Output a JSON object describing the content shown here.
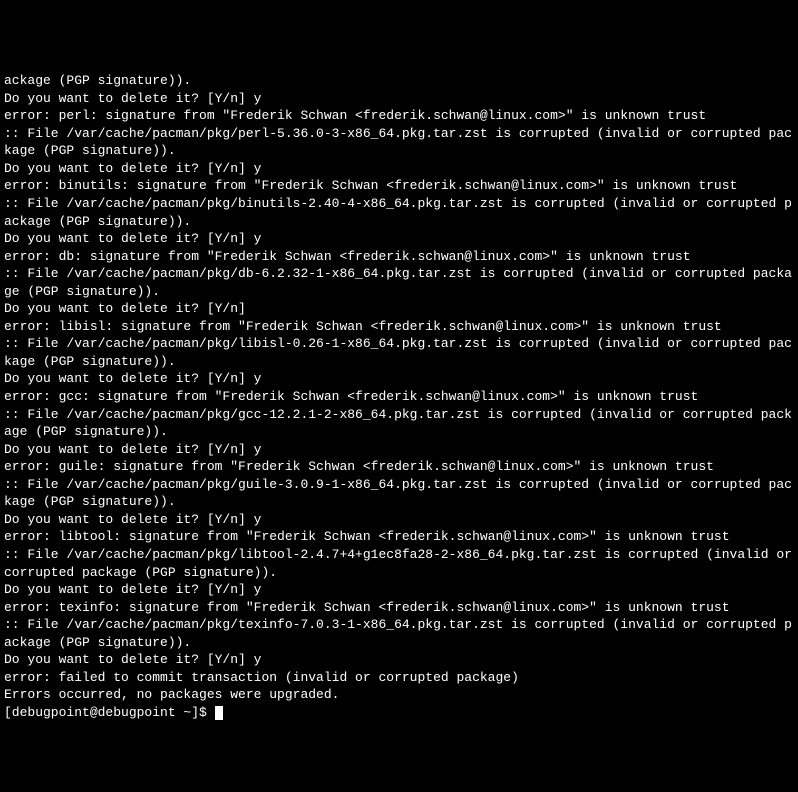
{
  "lines": [
    "ackage (PGP signature)).",
    "Do you want to delete it? [Y/n] y",
    "error: perl: signature from \"Frederik Schwan <frederik.schwan@linux.com>\" is unknown trust",
    ":: File /var/cache/pacman/pkg/perl-5.36.0-3-x86_64.pkg.tar.zst is corrupted (invalid or corrupted package (PGP signature)).",
    "Do you want to delete it? [Y/n] y",
    "error: binutils: signature from \"Frederik Schwan <frederik.schwan@linux.com>\" is unknown trust",
    ":: File /var/cache/pacman/pkg/binutils-2.40-4-x86_64.pkg.tar.zst is corrupted (invalid or corrupted package (PGP signature)).",
    "Do you want to delete it? [Y/n] y",
    "error: db: signature from \"Frederik Schwan <frederik.schwan@linux.com>\" is unknown trust",
    ":: File /var/cache/pacman/pkg/db-6.2.32-1-x86_64.pkg.tar.zst is corrupted (invalid or corrupted package (PGP signature)).",
    "Do you want to delete it? [Y/n]",
    "error: libisl: signature from \"Frederik Schwan <frederik.schwan@linux.com>\" is unknown trust",
    ":: File /var/cache/pacman/pkg/libisl-0.26-1-x86_64.pkg.tar.zst is corrupted (invalid or corrupted package (PGP signature)).",
    "Do you want to delete it? [Y/n] y",
    "error: gcc: signature from \"Frederik Schwan <frederik.schwan@linux.com>\" is unknown trust",
    ":: File /var/cache/pacman/pkg/gcc-12.2.1-2-x86_64.pkg.tar.zst is corrupted (invalid or corrupted package (PGP signature)).",
    "Do you want to delete it? [Y/n] y",
    "error: guile: signature from \"Frederik Schwan <frederik.schwan@linux.com>\" is unknown trust",
    ":: File /var/cache/pacman/pkg/guile-3.0.9-1-x86_64.pkg.tar.zst is corrupted (invalid or corrupted package (PGP signature)).",
    "Do you want to delete it? [Y/n] y",
    "error: libtool: signature from \"Frederik Schwan <frederik.schwan@linux.com>\" is unknown trust",
    ":: File /var/cache/pacman/pkg/libtool-2.4.7+4+g1ec8fa28-2-x86_64.pkg.tar.zst is corrupted (invalid or corrupted package (PGP signature)).",
    "Do you want to delete it? [Y/n] y",
    "error: texinfo: signature from \"Frederik Schwan <frederik.schwan@linux.com>\" is unknown trust",
    ":: File /var/cache/pacman/pkg/texinfo-7.0.3-1-x86_64.pkg.tar.zst is corrupted (invalid or corrupted package (PGP signature)).",
    "Do you want to delete it? [Y/n] y",
    "error: failed to commit transaction (invalid or corrupted package)",
    "Errors occurred, no packages were upgraded."
  ],
  "prompt": "[debugpoint@debugpoint ~]$ "
}
